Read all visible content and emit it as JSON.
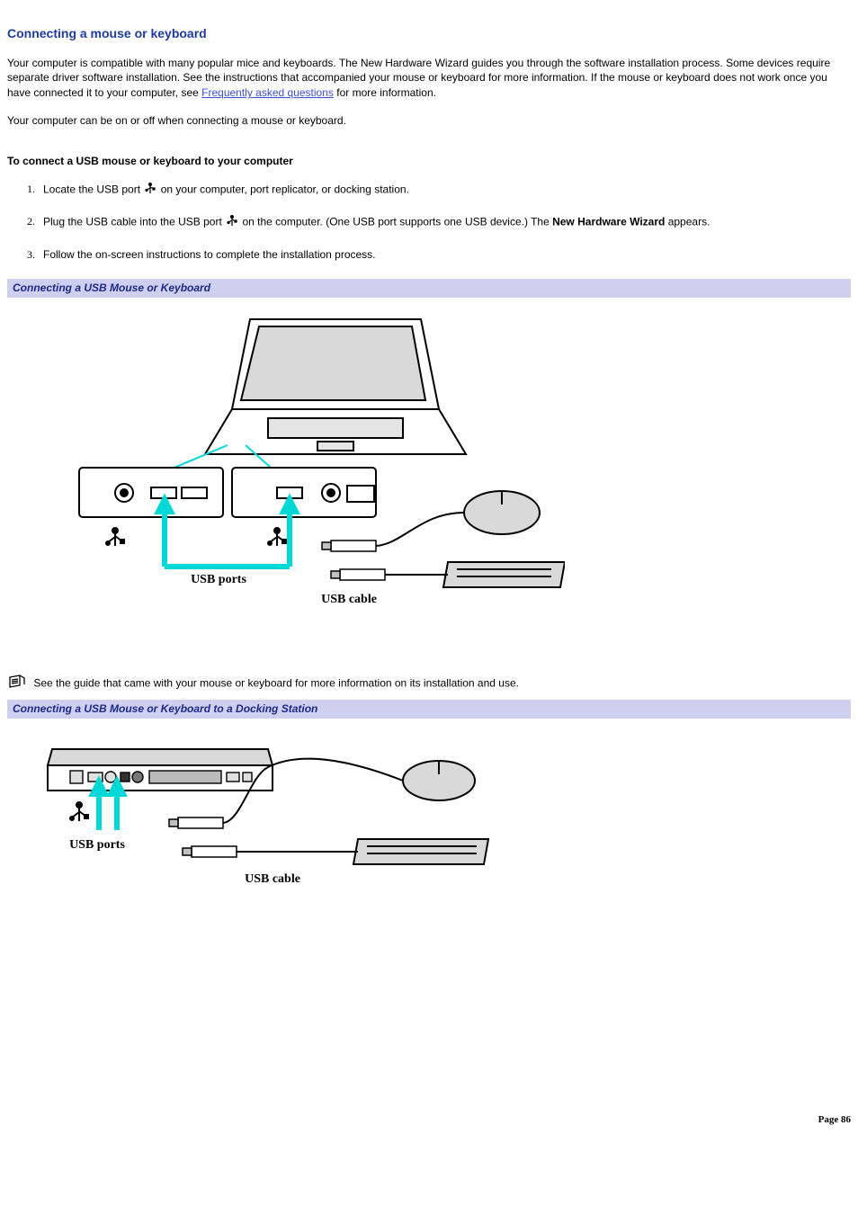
{
  "title": "Connecting a mouse or keyboard",
  "intro_a": "Your computer is compatible with many popular mice and keyboards. The New Hardware Wizard guides you through the software installation process. Some devices require separate driver software installation. See the instructions that accompanied your mouse or keyboard for more information. If the mouse or keyboard does not work once you have connected it to your computer, see ",
  "intro_link": "Frequently asked questions",
  "intro_b": " for more information.",
  "intro2": "Your computer can be on or off when connecting a mouse or keyboard.",
  "subhead": "To connect a USB mouse or keyboard to your computer",
  "steps": {
    "s1a": "Locate the USB port ",
    "s1b": " on your computer, port replicator, or docking station.",
    "s2a": "Plug the USB cable into the USB port ",
    "s2b": " on the computer. (One USB port supports one USB device.) The ",
    "s2bold": "New Hardware Wizard",
    "s2c": " appears.",
    "s3": "Follow the on-screen instructions to complete the installation process."
  },
  "fig1_caption": "Connecting a USB Mouse or Keyboard",
  "fig1_labels": {
    "ports": "USB ports",
    "cable": "USB cable"
  },
  "note_text": "See the guide that came with your mouse or keyboard for more information on its installation and use.",
  "fig2_caption": "Connecting a USB Mouse or Keyboard to a Docking Station",
  "fig2_labels": {
    "ports": "USB ports",
    "cable": "USB cable"
  },
  "page_footer": "Page 86"
}
